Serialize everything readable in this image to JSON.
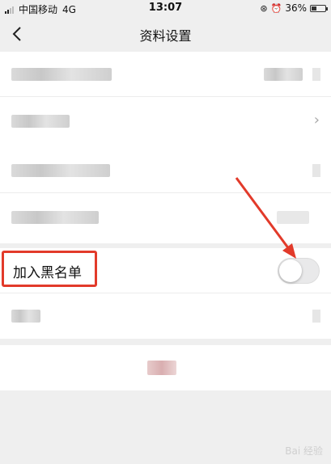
{
  "status_bar": {
    "carrier": "中国移动",
    "network": "4G",
    "time": "13:07",
    "battery_percent": "36%",
    "battery_level": 0.36
  },
  "nav": {
    "title": "资料设置"
  },
  "rows": {
    "blacklist_label": "加入黑名单",
    "blacklist_enabled": false
  },
  "colors": {
    "highlight": "#e23a2a",
    "arrow": "#e23a2a"
  },
  "watermark": "Bai 经验"
}
